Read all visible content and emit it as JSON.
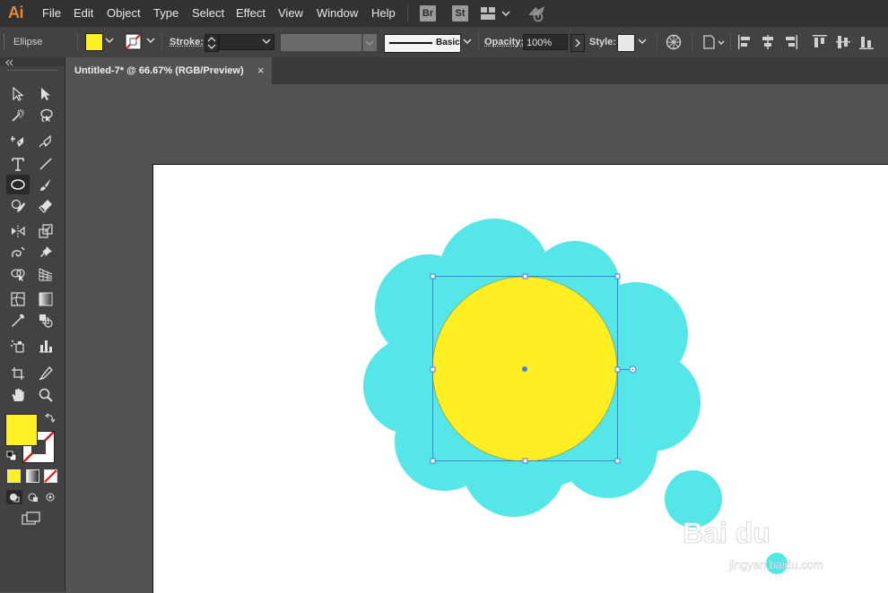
{
  "app": {
    "logo": "Ai"
  },
  "menu": {
    "items": [
      "File",
      "Edit",
      "Object",
      "Type",
      "Select",
      "Effect",
      "View",
      "Window",
      "Help"
    ],
    "bridge_label": "Br",
    "stock_label": "St"
  },
  "control_bar": {
    "selection_type": "Ellipse",
    "fill_color": "#ffee22",
    "stroke_label": "Stroke:",
    "brush_label": "Basic",
    "opacity_label": "Opacity:",
    "opacity_value": "100%",
    "style_label": "Style:"
  },
  "document": {
    "tab_title": "Untitled-7* @ 66.67% (RGB/Preview)",
    "close_glyph": "×"
  },
  "tools": {
    "fill_swatch": "#fff023",
    "stroke_swatch": "none"
  },
  "artwork": {
    "cloud_color": "#55e6e8",
    "sun_color": "#ffee22",
    "selection_color": "#4a7fd6"
  },
  "watermark": {
    "text": "Bai du",
    "subtext": "jingyan.baidu.com"
  }
}
